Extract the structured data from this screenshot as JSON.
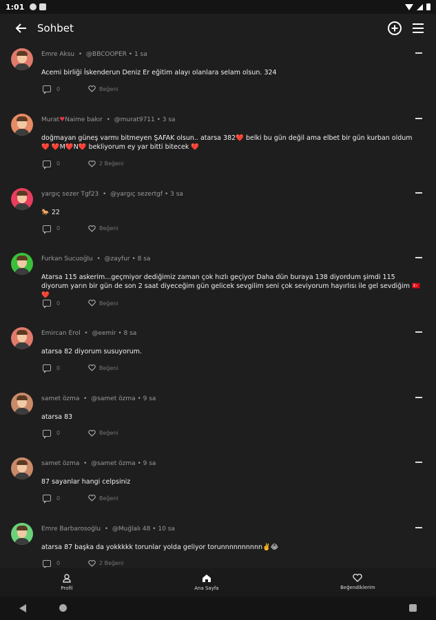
{
  "status_bar": {
    "time": "1:01"
  },
  "app_bar": {
    "title": "Sohbet"
  },
  "posts": [
    {
      "name": "Emre Aksu",
      "heart": "",
      "handle": "@BBCOOPER",
      "time": "1 sa",
      "text": "Acemi birliği İskenderun Deniz Er eğitim alayı olanlara selam olsun. 324",
      "comments": "0",
      "likes": "Beğeni",
      "avatar_bg": "#e07a6b",
      "tall": false
    },
    {
      "name": "Murat",
      "heart": "♥",
      "name2": "Naime bakır",
      "handle": "@murat9711",
      "time": "3 sa",
      "text": "doğmayan güneş varmı bitmeyen ŞAFAK olsun.. atarsa 382❤️ belki bu gün değil ama elbet bir gün kurban oldum❤️ ❤️M❤️N❤️ bekliyorum ey yar bitti bitecek ❤️",
      "comments": "0",
      "likes": "2 Beğeni",
      "avatar_bg": "#e78a66",
      "tall": true
    },
    {
      "name": "yargıç sezer Tgf23",
      "heart": "",
      "handle": "@yargıç sezertgf",
      "time": "3 sa",
      "text": "🐎 22",
      "comments": "0",
      "likes": "Beğeni",
      "avatar_bg": "#e83d5e",
      "tall": false
    },
    {
      "name": "Furkan Sucuoğlu",
      "heart": "",
      "handle": "@zayfur",
      "time": "8 sa",
      "text": "Atarsa 115 askerim...geçmiyor dediğimiz zaman çok hızlı geçiyor Daha dün buraya 138 diyordum şimdi 115 diyorum yarın bir gün de son 2 saat diyeceğim gün gelicek sevgilim seni çok seviyorum hayırlısı ile gel sevdiğim 🇹🇷❤️",
      "comments": "0",
      "likes": "Beğeni",
      "avatar_bg": "#3bbf3b",
      "tall": true
    },
    {
      "name": "Emircan Erol",
      "heart": "",
      "handle": "@eemir",
      "time": "8 sa",
      "text": "atarsa 82 diyorum susuyorum.",
      "comments": "0",
      "likes": "Beğeni",
      "avatar_bg": "#e07a6b",
      "tall": false
    },
    {
      "name": "samet özma",
      "heart": "",
      "handle": "@samet özma",
      "time": "9 sa",
      "text": "atarsa 83",
      "comments": "0",
      "likes": "Beğeni",
      "avatar_bg": "#c98a6a",
      "tall": false
    },
    {
      "name": "samet özma",
      "heart": "",
      "handle": "@samet özma",
      "time": "9 sa",
      "text": "87 sayanlar hangi celpsiniz",
      "comments": "0",
      "likes": "Beğeni",
      "avatar_bg": "#c98a6a",
      "tall": false
    },
    {
      "name": "Emre Barbarosoğlu",
      "heart": "",
      "handle": "@Muğlalı 48",
      "time": "10 sa",
      "text": "atarsa 87 başka da yokkkkk torunlar yolda geliyor torunnnnnnnnnn✌️😂",
      "comments": "0",
      "likes": "2 Beğeni",
      "avatar_bg": "#6bd17a",
      "tall": false
    }
  ],
  "bottom_nav": [
    {
      "label": "Profil",
      "icon": "person-icon"
    },
    {
      "label": "Ana Sayfa",
      "icon": "home-icon"
    },
    {
      "label": "Beğendiklerim",
      "icon": "heart-icon"
    }
  ]
}
